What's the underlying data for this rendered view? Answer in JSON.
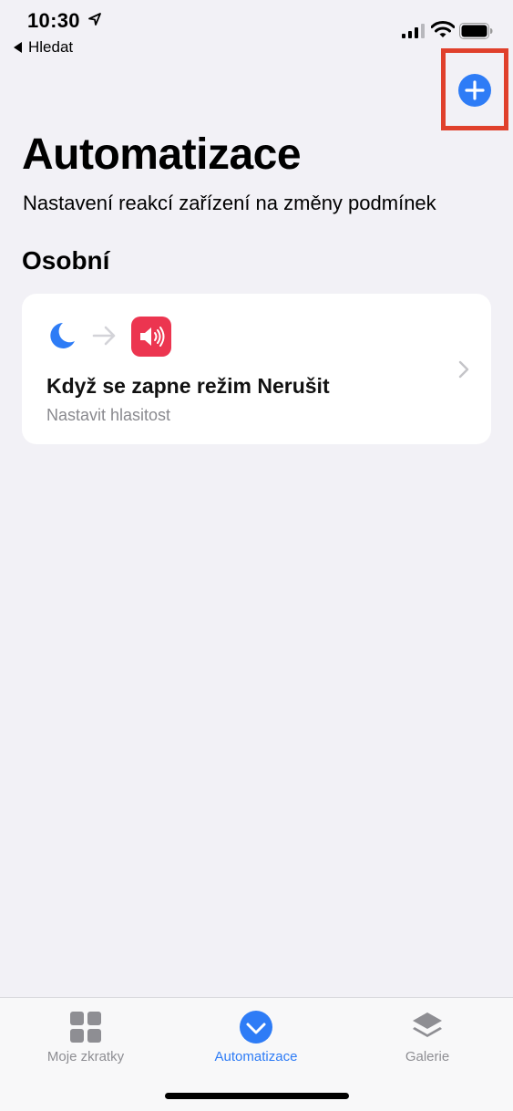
{
  "status_bar": {
    "time": "10:30",
    "icons": [
      "location-arrow-icon",
      "cellular-signal-icon",
      "wifi-icon",
      "battery-icon"
    ]
  },
  "nav": {
    "back_label": "Hledat",
    "add_button_icon": "plus-icon",
    "highlight_color": "#e0402c"
  },
  "header": {
    "title": "Automatizace",
    "subtitle": "Nastavení reakcí zařízení na změny podmínek"
  },
  "section": {
    "title": "Osobní"
  },
  "automation_card": {
    "trigger_icon": "moon-icon",
    "arrow_icon": "arrow-right-icon",
    "action_icon": "speaker-volume-icon",
    "title": "Když se zapne režim Nerušit",
    "subtitle": "Nastavit hlasitost"
  },
  "tab_bar": {
    "tabs": [
      {
        "label": "Moje zkratky",
        "icon": "grid-icon",
        "active": false
      },
      {
        "label": "Automatizace",
        "icon": "checkmark-circle-icon",
        "active": true
      },
      {
        "label": "Galerie",
        "icon": "layers-icon",
        "active": false
      }
    ]
  },
  "colors": {
    "accent": "#2e7cf6",
    "background": "#f2f1f6",
    "action_red": "#ec3550"
  }
}
